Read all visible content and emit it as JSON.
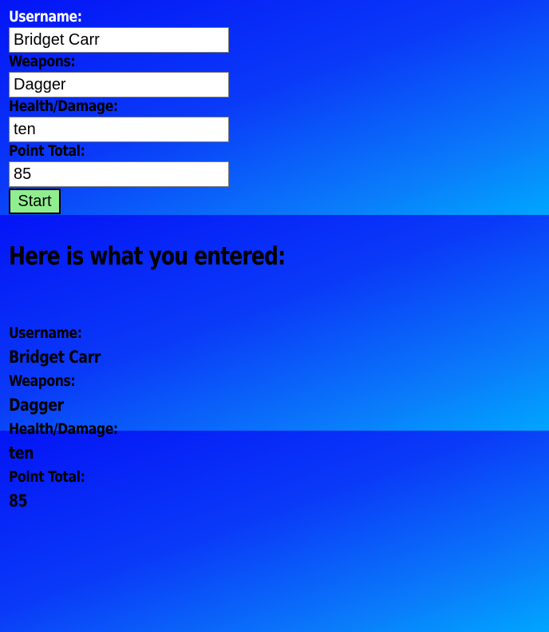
{
  "colors": {
    "background_start": "#0414f6",
    "background_end": "#00a6ff",
    "start_button": "#90ee90",
    "first_label": "#ffffff",
    "label": "#000000"
  },
  "form": {
    "username_label": "Username:",
    "username_value": "Bridget Carr",
    "weapons_label": "Weapons:",
    "weapons_value": "Dagger",
    "health_label": "Health/Damage:",
    "health_value": "ten",
    "points_label": "Point Total:",
    "points_value": "85",
    "start_label": "Start"
  },
  "results": {
    "heading": "Here is what you entered:",
    "username_label": "Username:",
    "username_value": "Bridget Carr",
    "weapons_label": "Weapons:",
    "weapons_value": "Dagger",
    "health_label": "Health/Damage:",
    "health_value": "ten",
    "points_label": "Point Total:",
    "points_value": "85"
  }
}
